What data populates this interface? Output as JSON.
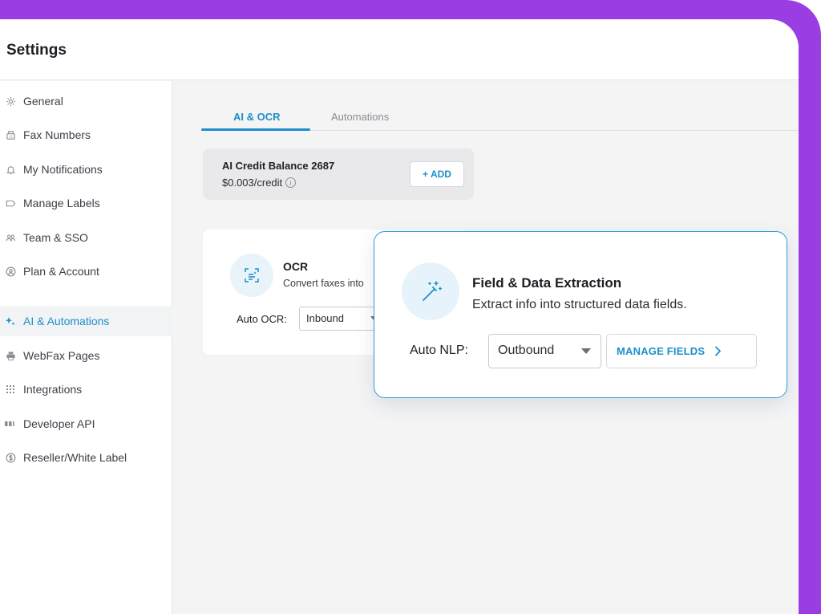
{
  "colors": {
    "accent": "#1c8fca",
    "frame": "#9a3ee3",
    "popup_border": "#2a9fd4"
  },
  "header": {
    "title": "Settings"
  },
  "sidebar": {
    "items": [
      {
        "label": "General",
        "icon": "gear-icon"
      },
      {
        "label": "Fax Numbers",
        "icon": "fax-icon"
      },
      {
        "label": "My Notifications",
        "icon": "bell-icon"
      },
      {
        "label": "Manage Labels",
        "icon": "label-icon"
      },
      {
        "label": "Team & SSO",
        "icon": "team-icon"
      },
      {
        "label": "Plan & Account",
        "icon": "account-icon"
      },
      {
        "label": "AI &  Automations",
        "icon": "sparkle-icon",
        "active": true
      },
      {
        "label": "WebFax Pages",
        "icon": "printer-icon"
      },
      {
        "label": "Integrations",
        "icon": "grid-icon"
      },
      {
        "label": "Developer API",
        "icon": "api-icon"
      },
      {
        "label": "Reseller/White Label",
        "icon": "dollar-icon"
      }
    ]
  },
  "tabs": [
    {
      "label": "AI & OCR",
      "active": true
    },
    {
      "label": "Automations",
      "active": false
    }
  ],
  "credit": {
    "title": "AI Credit Balance 2687",
    "rate": "$0.003/credit",
    "add_label": "+ ADD"
  },
  "ocr": {
    "title": "OCR",
    "description": "Convert faxes into",
    "auto_label": "Auto OCR:",
    "auto_value": "Inbound"
  },
  "extraction": {
    "title": "Field & Data Extraction",
    "description": "Extract info into structured data fields.",
    "auto_label": "Auto NLP:",
    "auto_value": "Outbound",
    "manage_label": "MANAGE FIELDS"
  }
}
